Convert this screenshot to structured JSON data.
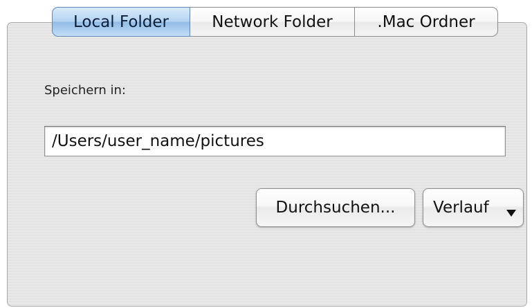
{
  "tabs": [
    {
      "label": "Local Folder",
      "selected": true
    },
    {
      "label": "Network Folder",
      "selected": false
    },
    {
      "label": ".Mac Ordner",
      "selected": false
    }
  ],
  "save_location": {
    "label": "Speichern in:",
    "path_value": "/Users/user_name/pictures"
  },
  "buttons": {
    "browse_label": "Durchsuchen...",
    "history_label": "Verlauf",
    "history_icon": "chevron-down-icon"
  },
  "colors": {
    "selected_tab": "#b4d4f2",
    "panel_background": "#e6e6e6"
  }
}
